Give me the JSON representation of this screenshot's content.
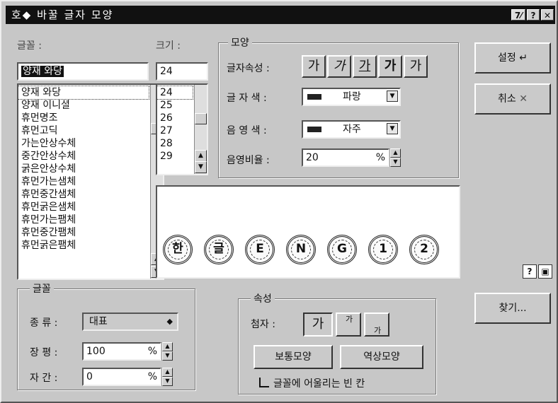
{
  "titlebar": {
    "title": "호◆ 바꿀 글자 모양",
    "help_label": "?",
    "close_label": "✕",
    "extra_label": "7⁄"
  },
  "font": {
    "label": "글꼴 :",
    "value": "양재 와당",
    "items": [
      "양재 와당",
      "양재 이니셜",
      "휴먼명조",
      "휴먼고딕",
      "가는안상수체",
      "중간안상수체",
      "굵은안상수체",
      "휴먼가는샘체",
      "휴먼중간샘체",
      "휴먼굵은샘체",
      "휴먼가는팸체",
      "휴먼중간팸체",
      "휴먼굵은팸체"
    ]
  },
  "size": {
    "label": "크기 :",
    "value": "24",
    "items": [
      "24",
      "25",
      "26",
      "27",
      "28",
      "29"
    ]
  },
  "shape_group": {
    "title": "모양",
    "attr_label": "글자속성 :",
    "attr_buttons": [
      "가",
      "가",
      "가",
      "가",
      "가"
    ],
    "color_label": "글 자 색 :",
    "color_value": "파랑",
    "shadow_label": "음 영 색 :",
    "shadow_value": "자주",
    "ratio_label": "음영비율 :",
    "ratio_value": "20",
    "ratio_unit": "%"
  },
  "buttons": {
    "ok": "설정",
    "cancel": "취소",
    "find": "찾기..."
  },
  "preview": {
    "seals": [
      "한",
      "글",
      "E",
      "N",
      "G",
      "1",
      "2"
    ]
  },
  "font_group": {
    "title": "글꼴",
    "type_label": "종 류 :",
    "type_value": "대표",
    "width_label": "장 평 :",
    "width_value": "100",
    "width_unit": "%",
    "spacing_label": "자 간 :",
    "spacing_value": "0",
    "spacing_unit": "%"
  },
  "prop_group": {
    "title": "속성",
    "sub_label": "첨자 :",
    "sub_options": [
      "가",
      "가",
      "가"
    ],
    "normal_button": "보통모양",
    "mirror_button": "역상모양",
    "fit_label": "글꼴에 어울리는 빈 칸"
  },
  "colors": {
    "window": "#c7c7c7",
    "title": "#111111"
  }
}
